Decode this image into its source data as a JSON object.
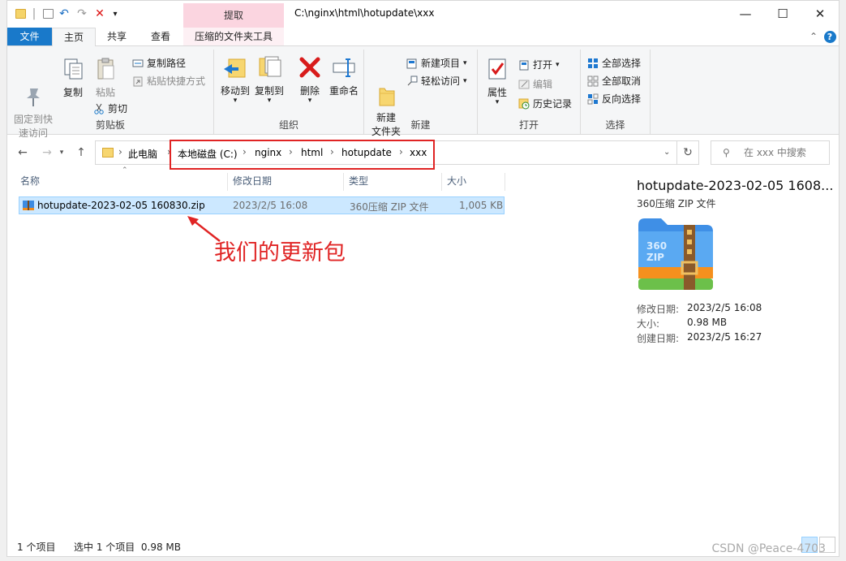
{
  "titlebar": {
    "context_tab": "提取",
    "path": "C:\\nginx\\html\\hotupdate\\xxx",
    "minimize": "—",
    "maximize": "☐",
    "close": "✕"
  },
  "tabs": {
    "file": "文件",
    "home": "主页",
    "share": "共享",
    "view": "查看",
    "compressed_tools": "压缩的文件夹工具"
  },
  "ribbon": {
    "clipboard": {
      "pin": "固定到快\n速访问",
      "copy": "复制",
      "paste": "粘贴",
      "copy_path": "复制路径",
      "paste_shortcut": "粘贴快捷方式",
      "cut": "剪切",
      "group": "剪贴板"
    },
    "organize": {
      "move_to": "移动到",
      "copy_to": "复制到",
      "delete": "删除",
      "rename": "重命名",
      "group": "组织"
    },
    "new": {
      "new_folder": "新建\n文件夹",
      "new_item": "新建项目",
      "easy_access": "轻松访问",
      "group": "新建"
    },
    "open": {
      "properties": "属性",
      "open": "打开",
      "edit": "编辑",
      "history": "历史记录",
      "group": "打开"
    },
    "select": {
      "select_all": "全部选择",
      "select_none": "全部取消",
      "invert": "反向选择",
      "group": "选择"
    }
  },
  "nav": {
    "breadcrumb": [
      "此电脑",
      "本地磁盘 (C:)",
      "nginx",
      "html",
      "hotupdate",
      "xxx"
    ],
    "search_placeholder": "在 xxx 中搜索"
  },
  "columns": [
    "名称",
    "修改日期",
    "类型",
    "大小"
  ],
  "files": [
    {
      "name": "hotupdate-2023-02-05 160830.zip",
      "date": "2023/2/5 16:08",
      "type": "360压缩 ZIP 文件",
      "size": "1,005 KB"
    }
  ],
  "annotation": "我们的更新包",
  "preview": {
    "title": "hotupdate-2023-02-05 1608...",
    "subtitle": "360压缩 ZIP 文件",
    "modified_label": "修改日期:",
    "modified": "2023/2/5 16:08",
    "size_label": "大小:",
    "size": "0.98 MB",
    "created_label": "创建日期:",
    "created": "2023/2/5 16:27"
  },
  "status": {
    "count": "1 个项目",
    "selected": "选中 1 个项目  0.98 MB"
  },
  "watermark": "CSDN @Peace-4703",
  "colors": {
    "accent": "#1979ca",
    "annotation": "#e02424",
    "selection": "#cce8ff"
  }
}
